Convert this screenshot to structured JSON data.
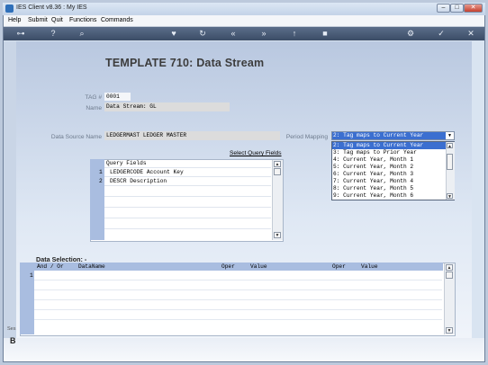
{
  "window": {
    "title": "IES Client v8.36 : My IES",
    "min_label": "–",
    "max_label": "□",
    "close_label": "✕"
  },
  "menu": [
    "Help",
    "Submit",
    "Quit",
    "Functions",
    "Commands"
  ],
  "toolbar": {
    "icons": [
      "key-icon",
      "help-icon",
      "search-icon",
      "heart-icon",
      "refresh-icon",
      "rewind-icon",
      "fast-forward-icon",
      "upload-icon",
      "stop-icon",
      "settings-icon",
      "check-icon",
      "close-icon"
    ],
    "glyphs": [
      "⊶",
      "?",
      "⌕",
      "♥",
      "↻",
      "«",
      "»",
      "↑",
      "■",
      "⚙",
      "✓",
      "✕"
    ]
  },
  "page": {
    "title": "TEMPLATE 710: Data Stream"
  },
  "form": {
    "tag_label": "TAG #",
    "tag_value": "0001",
    "name_label": "Name",
    "name_value": "Data Stream: GL",
    "ds_label": "Data Source Name",
    "ds_value": "LEDGERMAST LEDGER MASTER",
    "pm_label": "Period Mapping",
    "pm_value": "2: Tag maps to Current Year"
  },
  "period_options": [
    "2: Tag maps to Current Year",
    "3: Tag maps to Prior Year",
    "4: Current Year, Month 1",
    "5: Current Year, Month 2",
    "6: Current Year, Month 3",
    "7: Current Year, Month 4",
    "8: Current Year, Month 5",
    "9: Current Year, Month 6"
  ],
  "query": {
    "link": "Select Query Fields",
    "header": "Query Fields",
    "rows": [
      {
        "n": "1",
        "text": "LEDGERCODE Account Key"
      },
      {
        "n": "2",
        "text": "DESCR Description"
      }
    ]
  },
  "dsel": {
    "title": "Data Selection: -",
    "cols": [
      "And / Or",
      "DataName",
      "Oper",
      "Value",
      "Oper",
      "Value"
    ],
    "row_numbers": [
      "1"
    ]
  },
  "status": {
    "left_text": "Ses",
    "left_icon_glyph": "B"
  }
}
